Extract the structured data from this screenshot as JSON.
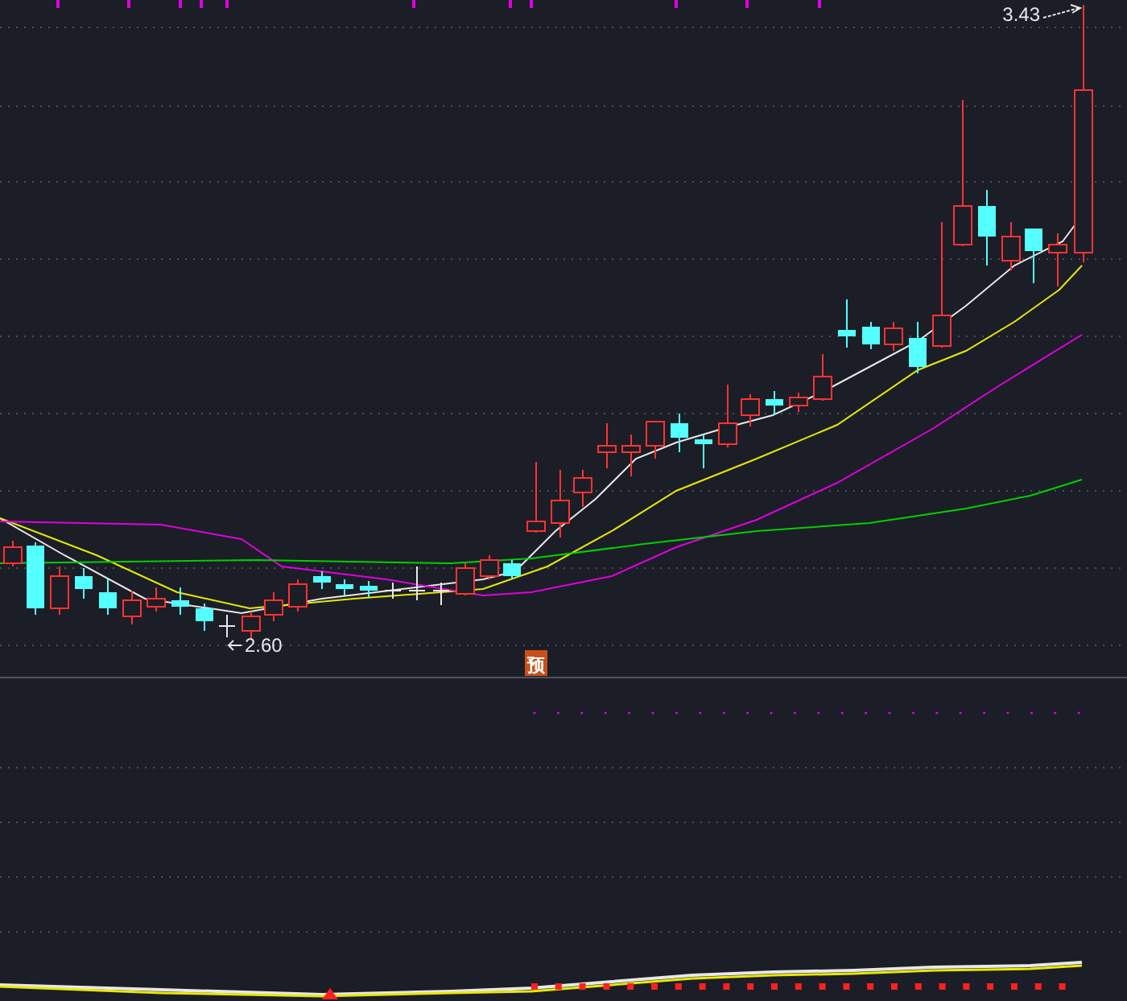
{
  "price_chart": {
    "high_label": "3.43",
    "low_label": "2.60",
    "forecast_badge": "预"
  }
}
